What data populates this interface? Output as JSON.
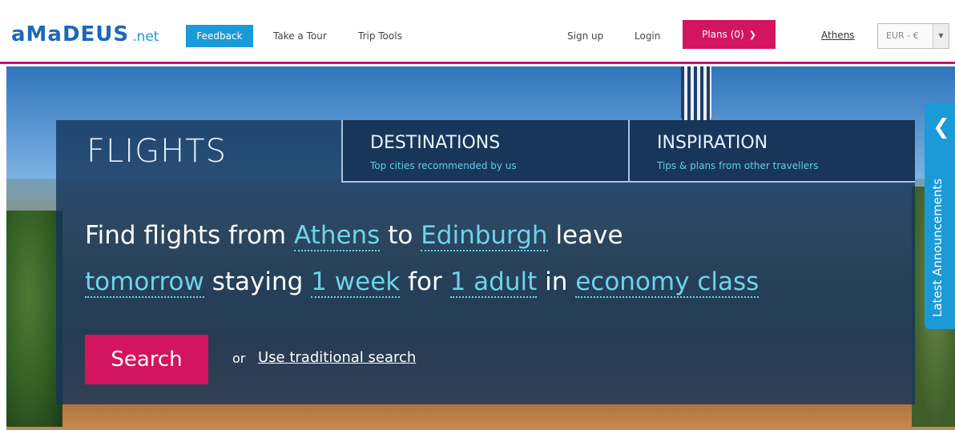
{
  "header": {
    "logo_main": "aMaDEUS",
    "logo_suffix": ".net",
    "feedback_label": "Feedback",
    "take_tour_label": "Take a Tour",
    "trip_tools_label": "Trip Tools",
    "sign_up_label": "Sign up",
    "login_label": "Login",
    "plans_label": "Plans (0)",
    "city_label": "Athens",
    "currency_value": "EUR - €"
  },
  "tabs": {
    "flights": "FLIGHTS",
    "destinations": {
      "title": "DESTINATIONS",
      "subtitle": "Top cities recommended by us"
    },
    "inspiration": {
      "title": "INSPIRATION",
      "subtitle": "Tips & plans from other travellers"
    }
  },
  "search": {
    "t1": "Find flights from",
    "origin": "Athens",
    "t2": "to",
    "destination": "Edinburgh",
    "t3": "leave",
    "departure": "tomorrow",
    "t4": "staying",
    "duration": "1 week",
    "t5": "for",
    "travellers": "1 adult",
    "t6": "in",
    "cabin": "economy class",
    "search_label": "Search",
    "or_label": "or",
    "traditional_label": "Use traditional search"
  },
  "announcements": {
    "label": "Latest Announcements"
  },
  "colors": {
    "brand_blue": "#1b69b6",
    "accent_pink": "#d3145f",
    "feedback_blue": "#1a9ad6",
    "highlight_cyan": "#6fd3e8"
  }
}
